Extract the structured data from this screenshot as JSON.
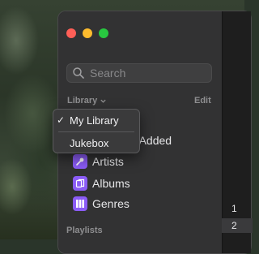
{
  "search": {
    "placeholder": "Search"
  },
  "sidebar": {
    "library_header": "Library",
    "edit_label": "Edit",
    "items": [
      {
        "label": "Recently Added",
        "visible_fragment": "Added",
        "icon": "clock-icon"
      },
      {
        "label": "Artists",
        "icon": "microphone-icon"
      },
      {
        "label": "Albums",
        "icon": "album-icon"
      },
      {
        "label": "Genres",
        "icon": "genres-icon"
      }
    ],
    "playlists_header": "Playlists"
  },
  "library_menu": {
    "items": [
      {
        "label": "My Library",
        "checked": true
      },
      {
        "label": "Jukebox",
        "checked": false
      }
    ],
    "check_glyph": "✓"
  },
  "track_numbers": [
    "1",
    "2"
  ],
  "colors": {
    "close": "#ff5f57",
    "minimize": "#febc2e",
    "maximize": "#28c840",
    "icon_accent": "#8b5cf6"
  }
}
